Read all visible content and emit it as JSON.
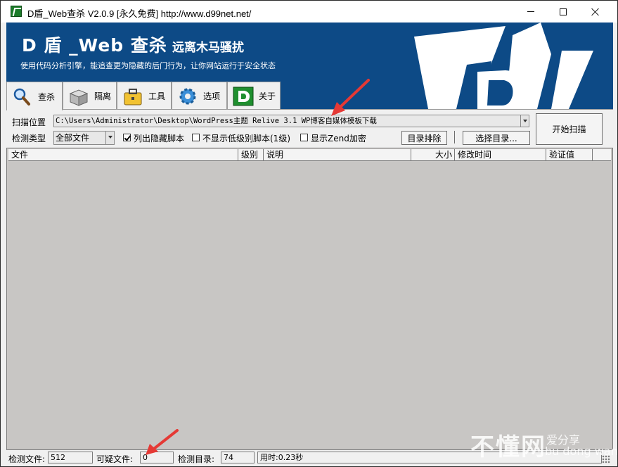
{
  "window": {
    "title": "D盾_Web查杀 V2.0.9 [永久免费] http://www.d99net.net/"
  },
  "banner": {
    "title": "D 盾 _Web 查杀",
    "slogan": "远离木马骚扰",
    "subtitle": "使用代码分析引擎，能追查更为隐藏的后门行为，让你网站运行于安全状态",
    "logo_text": "D",
    "color": "#0d4a86"
  },
  "tabs": [
    {
      "label": "查杀",
      "icon": "magnifier-icon",
      "active": true
    },
    {
      "label": "隔离",
      "icon": "box-icon",
      "active": false
    },
    {
      "label": "工具",
      "icon": "briefcase-icon",
      "active": false
    },
    {
      "label": "选项",
      "icon": "gear-icon",
      "active": false
    },
    {
      "label": "关于",
      "icon": "d-logo-icon",
      "active": false
    }
  ],
  "scan": {
    "path_label": "扫描位置",
    "path_value": "C:\\Users\\Administrator\\Desktop\\WordPress主题 Relive 3.1 WP博客自媒体模板下载",
    "type_label": "检测类型",
    "type_value": "全部文件",
    "checkbox_hidden": {
      "label": "列出隐藏脚本",
      "checked": true
    },
    "checkbox_lowlevel": {
      "label": "不显示低级别脚本(1级)",
      "checked": false
    },
    "checkbox_zend": {
      "label": "显示Zend加密",
      "checked": false
    },
    "exclude_button": "目录排除",
    "select_dir_button": "选择目录...",
    "start_button": "开始扫描"
  },
  "table": {
    "columns": [
      "文件",
      "级别",
      "说明",
      "大小",
      "修改时间",
      "验证值"
    ],
    "rows": []
  },
  "status": {
    "files_label": "检测文件:",
    "files_value": "512",
    "suspicious_label": "可疑文件:",
    "suspicious_value": "0",
    "dirs_label": "检测目录:",
    "dirs_value": "74",
    "time_value": "用时:0.23秒"
  },
  "watermark": {
    "big": "不懂网",
    "small1": "爱分享",
    "small2": "bu dong wang"
  },
  "colors": {
    "arrow": "#e53935",
    "list_bg": "#c8c6c4"
  }
}
